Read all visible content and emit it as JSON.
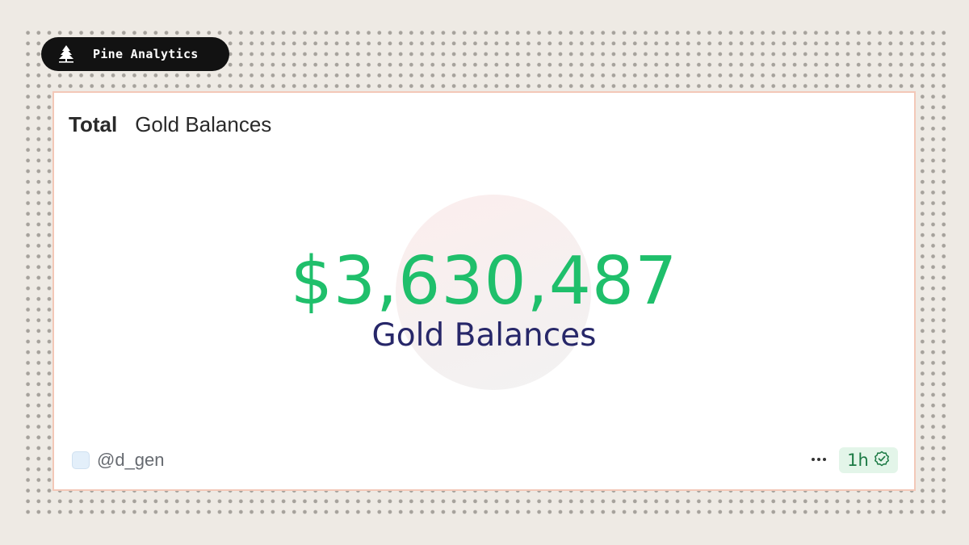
{
  "brand": {
    "name": "Pine Analytics",
    "logo_icon": "pine-tree-icon"
  },
  "card": {
    "title_bold": "Total",
    "title_rest": "Gold Balances",
    "counter": {
      "value": "$3,630,487",
      "label": "Gold Balances",
      "value_color": "#1fbf6b",
      "label_color": "#272769"
    },
    "footer": {
      "user": "@d_gen",
      "more_icon": "ellipsis-icon",
      "refresh_label": "1h",
      "refresh_icon": "check-badge-icon"
    }
  }
}
